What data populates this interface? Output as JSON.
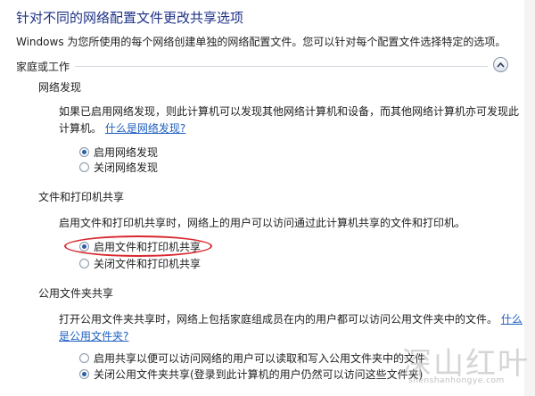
{
  "page": {
    "title": "针对不同的网络配置文件更改共享选项",
    "description": "Windows 为您所使用的每个网络创建单独的网络配置文件。您可以针对每个配置文件选择特定的选项。"
  },
  "group": {
    "header": "家庭或工作",
    "collapse_icon": "chevron-up-icon"
  },
  "network_discovery": {
    "title": "网络发现",
    "description_line1": "如果已启用网络发现，则此计算机可以发现其他网络计算机和设备，而其他网络计算机亦可发现此",
    "description_line2": "计算机。",
    "link": "什么是网络发现?",
    "options": [
      {
        "label": "启用网络发现",
        "checked": true
      },
      {
        "label": "关闭网络发现",
        "checked": false
      }
    ]
  },
  "file_printer_sharing": {
    "title": "文件和打印机共享",
    "description": "启用文件和打印机共享时，网络上的用户可以访问通过此计算机共享的文件和打印机。",
    "options": [
      {
        "label": "启用文件和打印机共享",
        "checked": true
      },
      {
        "label": "关闭文件和打印机共享",
        "checked": false
      }
    ],
    "highlight_color": "#d9282e"
  },
  "public_folder_sharing": {
    "title": "公用文件夹共享",
    "description_line1": "打开公用文件夹共享时，网络上包括家庭组成员在内的用户都可以访问公用文件夹中的文件。",
    "link_line1": "什么",
    "link_line2": "是公用文件夹?",
    "options": [
      {
        "label": "启用共享以便可以访问网络的用户可以读取和写入公用文件夹中的文件",
        "checked": false
      },
      {
        "label": "关闭公用文件夹共享(登录到此计算机的用户仍然可以访问这些文件夹)",
        "checked": true
      }
    ]
  },
  "watermark": {
    "text": "深山红叶",
    "url": "shenshanhongye.com"
  },
  "colors": {
    "title": "#1e3287",
    "link": "#1f5fbf",
    "radio_dot": "#2a5ea8"
  }
}
